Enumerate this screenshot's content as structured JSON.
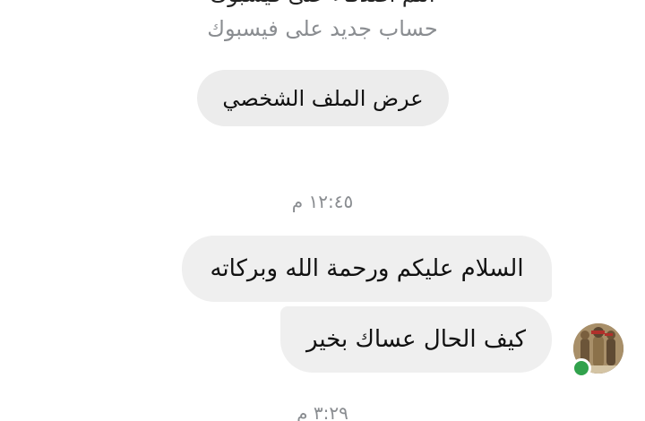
{
  "profile": {
    "header_cut_text": "انتم اصدقاء على فيسبوك",
    "subtitle": "حساب جديد على فيسبوك",
    "view_profile_label": "عرض الملف الشخصي"
  },
  "conversation": {
    "timestamps": [
      "١٢:٤٥ م",
      "٣:٢٩ م"
    ],
    "messages": [
      {
        "text": "السلام عليكم ورحمة الله وبركاته"
      },
      {
        "text": "كيف الحال عساك بخير"
      }
    ]
  },
  "contact": {
    "status": "online",
    "status_color": "#31a24c"
  },
  "colors": {
    "bubble_background": "#efefef",
    "muted_text": "#8a8d91"
  }
}
